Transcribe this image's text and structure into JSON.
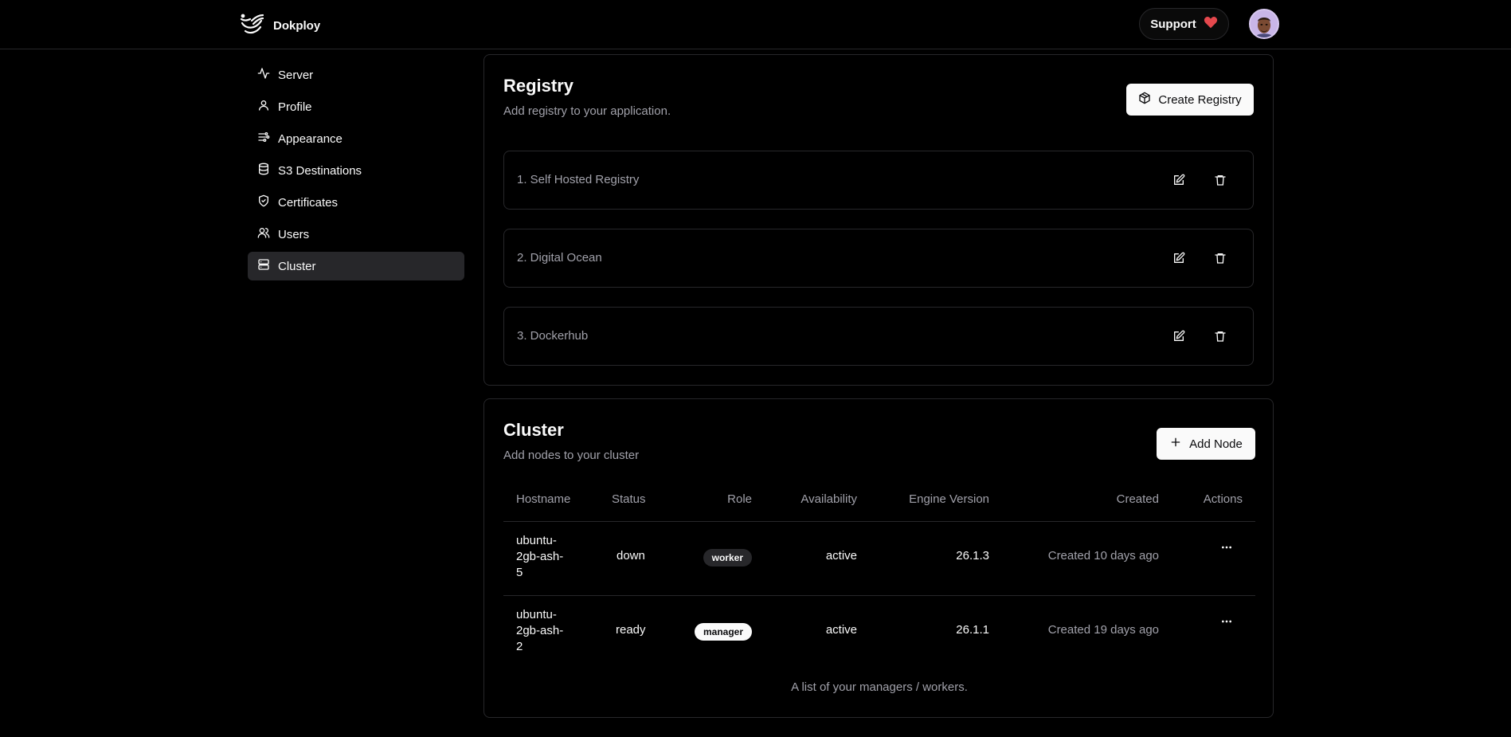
{
  "header": {
    "brand": "Dokploy",
    "support_label": "Support"
  },
  "sidebar": {
    "items": [
      {
        "label": "Server",
        "icon": "activity-icon"
      },
      {
        "label": "Profile",
        "icon": "user-icon"
      },
      {
        "label": "Appearance",
        "icon": "palette-icon"
      },
      {
        "label": "S3 Destinations",
        "icon": "database-icon"
      },
      {
        "label": "Certificates",
        "icon": "shield-check-icon"
      },
      {
        "label": "Users",
        "icon": "users-icon"
      },
      {
        "label": "Cluster",
        "icon": "server-icon",
        "active": true
      }
    ]
  },
  "registry": {
    "title": "Registry",
    "description": "Add registry to your application.",
    "create_label": "Create Registry",
    "items": [
      {
        "name": "1. Self Hosted Registry"
      },
      {
        "name": "2. Digital Ocean"
      },
      {
        "name": "3. Dockerhub"
      }
    ]
  },
  "cluster": {
    "title": "Cluster",
    "description": "Add nodes to your cluster",
    "add_label": "Add Node",
    "columns": {
      "hostname": "Hostname",
      "status": "Status",
      "role": "Role",
      "availability": "Availability",
      "engine": "Engine Version",
      "created": "Created",
      "actions": "Actions"
    },
    "rows": [
      {
        "host_l1": "ubuntu-",
        "host_l2": "2gb-ash-",
        "host_l3": "5",
        "status": "down",
        "role": "worker",
        "availability": "active",
        "engine": "26.1.3",
        "created": "Created 10 days ago"
      },
      {
        "host_l1": "ubuntu-",
        "host_l2": "2gb-ash-",
        "host_l3": "2",
        "status": "ready",
        "role": "manager",
        "availability": "active",
        "engine": "26.1.1",
        "created": "Created 19 days ago"
      }
    ],
    "caption": "A list of your managers / workers."
  },
  "colors": {
    "background": "#000000",
    "border": "#27272a",
    "muted_text": "#a1a1aa",
    "heart": "#e5484d"
  }
}
